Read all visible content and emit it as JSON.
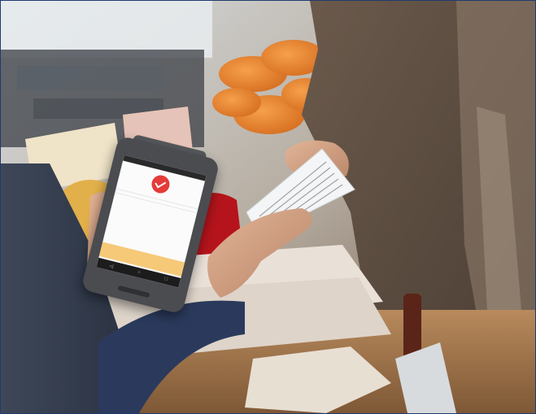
{
  "scene": {
    "description_tags": [
      "photo",
      "payment-terminal",
      "receipt",
      "market-stall"
    ],
    "colors": {
      "frame_border": "#1f3b6e",
      "screen_accent": "#e53c38",
      "total_bar": "#f6c979",
      "terminal_body": "#4a4c50"
    }
  },
  "terminal_screen": {
    "title": "",
    "line1": "",
    "line2": "",
    "row1_left": "",
    "row1_right": "",
    "row2_left": "",
    "row2_right": "",
    "total": "",
    "nav_back": "◁",
    "nav_home": "○",
    "nav_recent": "□"
  }
}
